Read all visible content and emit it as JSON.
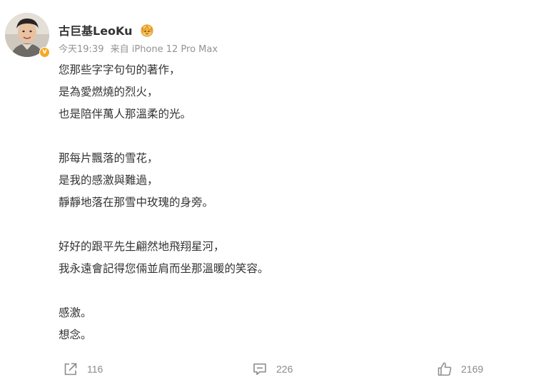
{
  "post": {
    "author": "古巨基LeoKu",
    "time": "今天19:39",
    "source": "来自 iPhone 12 Pro Max",
    "paragraphs": [
      [
        "您那些字字句句的著作，",
        "是為愛燃燒的烈火，",
        "也是陪伴萬人那溫柔的光。"
      ],
      [
        "那每片飄落的雪花，",
        "是我的感激與難過，",
        "靜靜地落在那雪中玫瑰的身旁。"
      ],
      [
        "好好的跟平先生翩然地飛翔星河，",
        "我永遠會記得您倆並肩而坐那溫暖的笑容。"
      ],
      [
        "感激。",
        "想念。"
      ]
    ]
  },
  "actions": {
    "share_count": "116",
    "comment_count": "226",
    "like_count": "2169"
  },
  "colors": {
    "text": "#333333",
    "meta": "#939393",
    "action": "#8a8a8a",
    "vip_gold": "#f2b03c",
    "badge": "#f7a823"
  },
  "icons": [
    "avatar",
    "verified-badge-icon",
    "vip-crown-icon",
    "share-icon",
    "comment-icon",
    "like-icon"
  ]
}
